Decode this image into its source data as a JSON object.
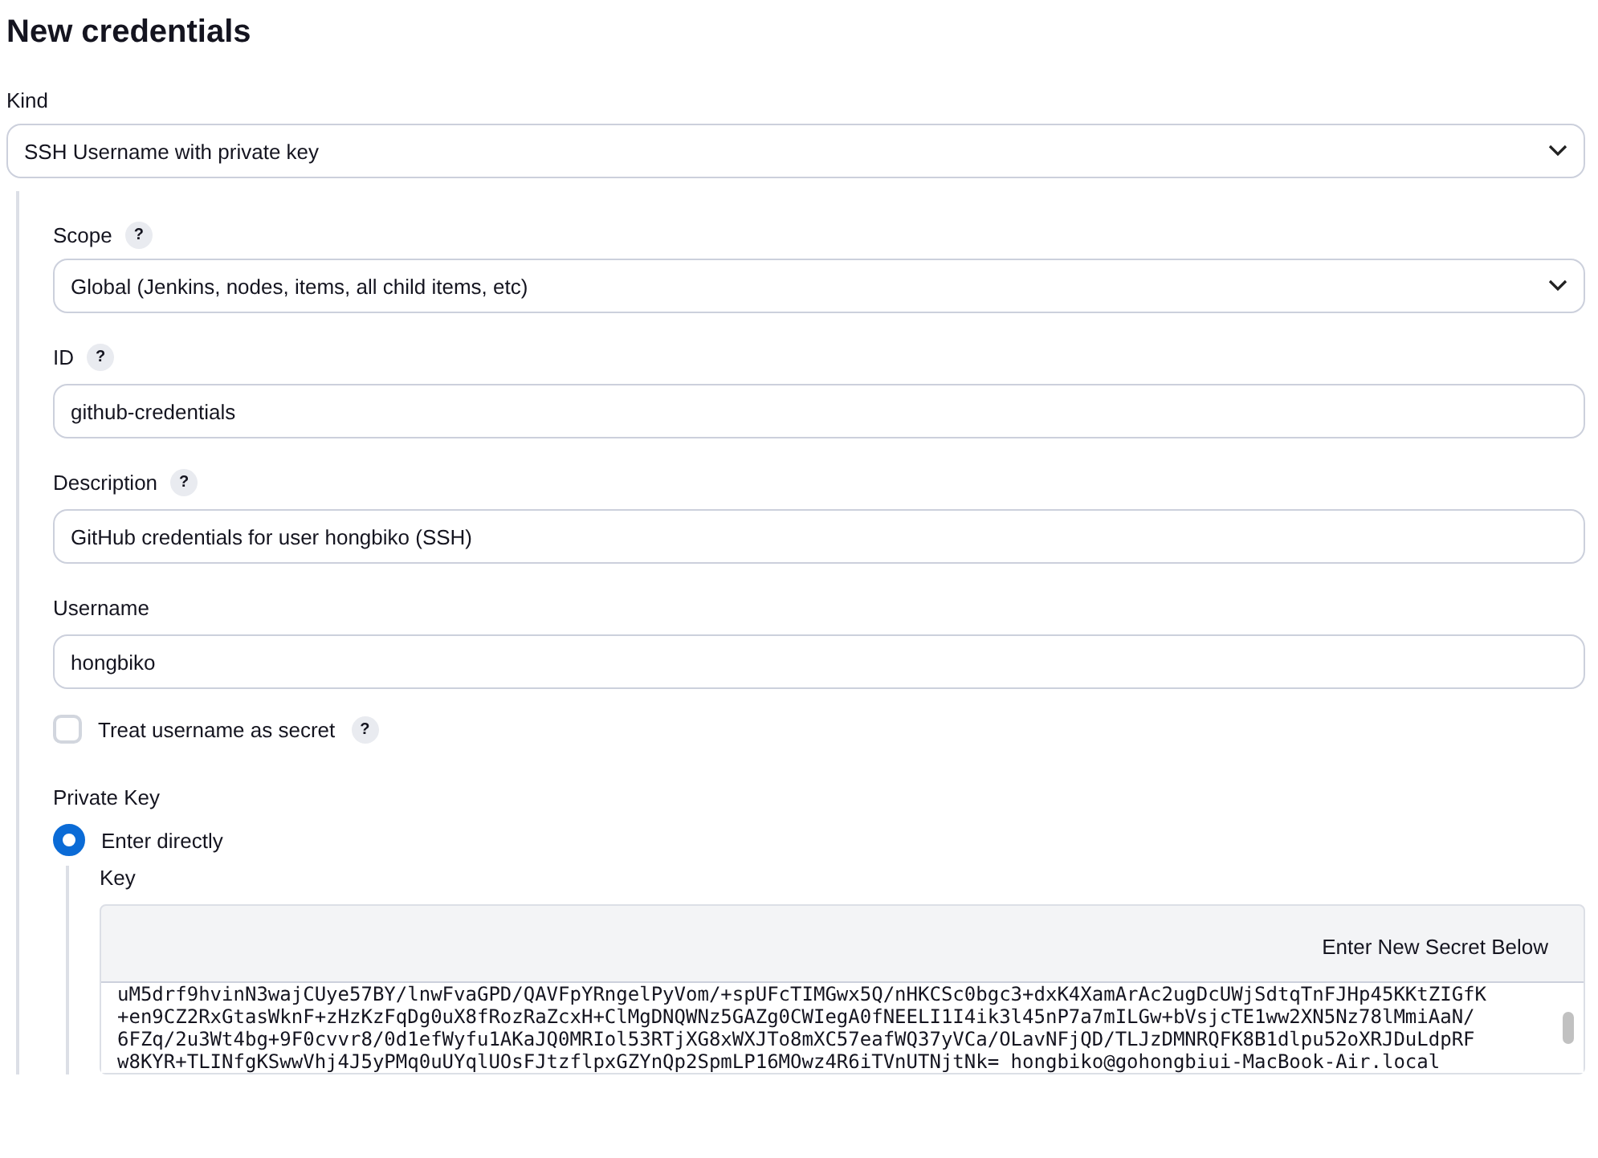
{
  "title": "New credentials",
  "kind": {
    "label": "Kind",
    "value": "SSH Username with private key"
  },
  "fields": [
    {
      "kind": "select",
      "label": "Scope",
      "help": "?",
      "value": "Global (Jenkins, nodes, items, all child items, etc)"
    },
    {
      "kind": "text",
      "label": "ID",
      "help": "?",
      "value": "github-credentials"
    },
    {
      "kind": "text",
      "label": "Description",
      "help": "?",
      "value": "GitHub credentials for user hongbiko (SSH)"
    },
    {
      "kind": "text",
      "label": "Username",
      "value": "hongbiko"
    },
    {
      "kind": "checkbox",
      "label": "Treat username as secret",
      "help": "?",
      "checked": false
    }
  ],
  "private_key": {
    "label": "Private Key",
    "options": [
      {
        "label": "Enter directly",
        "selected": true
      }
    ],
    "key": {
      "label": "Key",
      "button": "Enter New Secret Below",
      "lines": [
        "uM5drf9hvinN3wajCUye57BY/lnwFvaGPD/QAVFpYRngelPyVom/+spUFcTIMGwx5Q/nHKCSc0bgc3+dxK4XamArAc2ugDcUWjSdtqTnFJHp45KKtZIGfK",
        "+en9CZ2RxGtasWknF+zHzKzFqDg0uX8fRozRaZcxH+ClMgDNQWNz5GAZg0CWIegA0fNEELI1I4ik3l45nP7a7mILGw+bVsjcTE1ww2XN5Nz78lMmiAaN/",
        "6FZq/2u3Wt4bg+9F0cvvr8/0d1efWyfu1AKaJQ0MRIol53RTjXG8xWXJTo8mXC57eafWQ37yVCa/OLavNFjQD/TLJzDMNRQFK8B1dlpu52oXRJDuLdpRF",
        "w8KYR+TLINfgKSwwVhj4J5yPMq0uUYqlUOsFJtzflpxGZYnQp2SpmLP16MOwz4R6iTVnUTNjtNk= hongbiko@gohongbiui-MacBook-Air.local"
      ]
    }
  }
}
